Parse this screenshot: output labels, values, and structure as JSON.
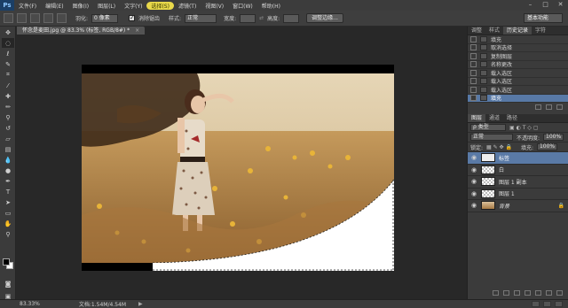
{
  "app": {
    "logo": "Ps",
    "menus": [
      "文件(F)",
      "编辑(E)",
      "图像(I)",
      "图层(L)",
      "文字(Y)",
      "选择(S)",
      "滤镜(T)",
      "视图(V)",
      "窗口(W)",
      "帮助(H)"
    ],
    "highlighted_menu_index": 5,
    "window_controls": [
      "–",
      "□",
      "✕"
    ]
  },
  "options_bar": {
    "feather_label": "羽化:",
    "feather_value": "0 像素",
    "antialias_label": "消除锯齿",
    "style_label": "样式:",
    "style_value": "正常",
    "width_label": "宽度:",
    "height_label": "高度:",
    "refine_edge_button": "调整边缘...",
    "workspace": "基本功能"
  },
  "document": {
    "tab_title": "怀念是麦田.jpg @ 83.3% (标签, RGB/8#) *",
    "zoom": "83.33%",
    "doc_size": "文档:1.54M/4.54M"
  },
  "history_panel": {
    "tabs": [
      "调整",
      "样式",
      "历史记录",
      "字符"
    ],
    "active_tab_index": 2,
    "items": [
      "填充",
      "取消选择",
      "复制图层",
      "名称更改",
      "载入选区",
      "载入选区",
      "载入选区",
      "填充"
    ],
    "selected_index": 7
  },
  "layers_panel": {
    "tabs": [
      "图层",
      "通道",
      "路径"
    ],
    "active_tab_index": 0,
    "kind_label": "ρ 类型",
    "blend_mode": "正常",
    "opacity_label": "不透明度:",
    "opacity_value": "100%",
    "lock_label": "锁定:",
    "fill_label": "填充:",
    "fill_value": "100%",
    "layers": [
      {
        "name": "标签",
        "thumb": "curl",
        "selected": true
      },
      {
        "name": "白",
        "thumb": "checker",
        "selected": false
      },
      {
        "name": "图层 1 副本",
        "thumb": "checker",
        "selected": false
      },
      {
        "name": "图层 1",
        "thumb": "checker",
        "selected": false
      },
      {
        "name": "背景",
        "thumb": "photo",
        "selected": false,
        "locked": true
      }
    ]
  },
  "colors": {
    "menu_highlight": "#e8d84a",
    "selection_blue": "#5a7aa6",
    "photo_warm": "#c9a26b"
  }
}
